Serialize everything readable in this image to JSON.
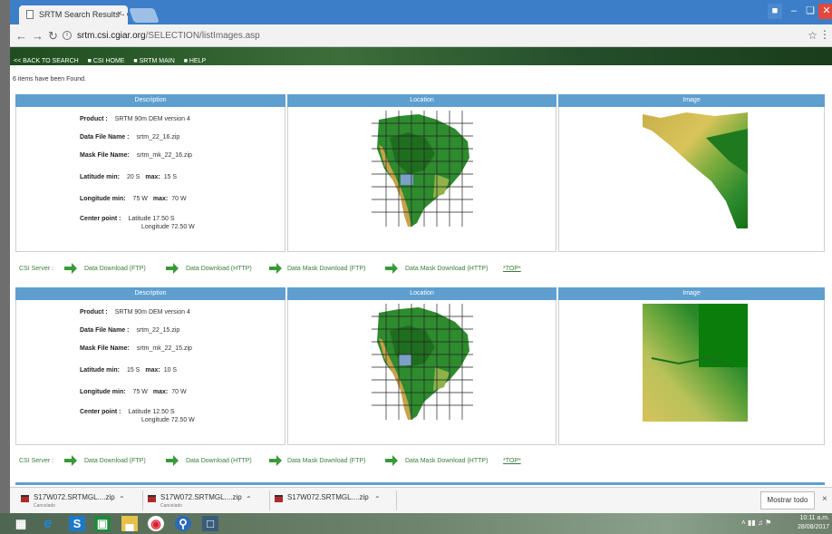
{
  "browser": {
    "tab_title": "SRTM Search Results - C",
    "tab_close": "×",
    "url_host": "srtm.csi.cgiar.org",
    "url_path": "/SELECTION/listImages.asp"
  },
  "site_menu": {
    "back": "<< BACK TO SEARCH",
    "csi_home": "■ CSI HOME",
    "srtm_main": "■ SRTM MAIN",
    "help": "■ HELP"
  },
  "found_text": "6 items have been Found.",
  "table_headers": {
    "description": "Description",
    "location": "Location",
    "image": "Image"
  },
  "labels": {
    "product": "Product :",
    "data_file": "Data File Name :",
    "mask_file": "Mask File Name:",
    "lat_min": "Latitude min:",
    "max": "max:",
    "lon_min": "Longitude min:",
    "center": "Center point :"
  },
  "results": [
    {
      "product": "SRTM 90m DEM version 4",
      "data_file": "srtm_22_16.zip",
      "mask_file": "srtm_mk_22_16.zip",
      "lat_min": "20 S",
      "lat_max": "15 S",
      "lon_min": "75 W",
      "lon_max": "70 W",
      "center_lat": "Latitude 17.50 S",
      "center_lon": "Longitude 72.50 W"
    },
    {
      "product": "SRTM 90m DEM version 4",
      "data_file": "srtm_22_15.zip",
      "mask_file": "srtm_mk_22_15.zip",
      "lat_min": "15 S",
      "lat_max": "10 S",
      "lon_min": "75 W",
      "lon_max": "70 W",
      "center_lat": "Latitude 12.50 S",
      "center_lon": "Longitude 72.50 W"
    }
  ],
  "download_row": {
    "server": "CSI Server :",
    "ftp": "Data Download (FTP)",
    "http": "Data Download (HTTP)",
    "mask_ftp": "Data Mask Download (FTP)",
    "mask_http": "Data Mask Download (HTTP)",
    "top": "*TOP*"
  },
  "downloads": [
    {
      "name": "S17W072.SRTMGL....zip",
      "status": "Cancelado"
    },
    {
      "name": "S17W072.SRTMGL....zip",
      "status": "Cancelado"
    },
    {
      "name": "S17W072.SRTMGL....zip",
      "status": ""
    }
  ],
  "download_bar": {
    "show_all": "Mostrar todo",
    "close": "×"
  },
  "taskbar": {
    "time": "10:11 a.m.",
    "date": "28/08/2017"
  },
  "colors": {
    "header_blue": "#5e9fcf",
    "link_green": "#3a7d3a",
    "titlebar": "#3c7ec7"
  }
}
